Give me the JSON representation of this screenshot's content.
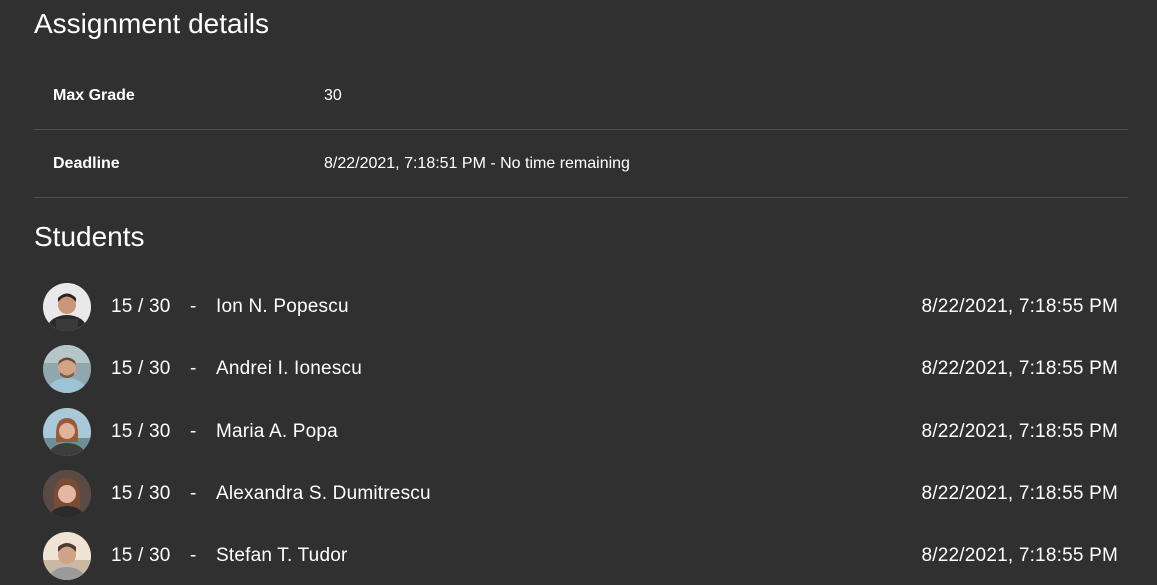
{
  "details": {
    "title": "Assignment details",
    "rows": [
      {
        "label": "Max Grade",
        "value": "30"
      },
      {
        "label": "Deadline",
        "value": "8/22/2021, 7:18:51 PM - No time remaining"
      }
    ]
  },
  "students": {
    "title": "Students",
    "separator": "-",
    "items": [
      {
        "grade": "15 / 30",
        "name": "Ion N. Popescu",
        "submitted_at": "8/22/2021, 7:18:55 PM"
      },
      {
        "grade": "15 / 30",
        "name": "Andrei I. Ionescu",
        "submitted_at": "8/22/2021, 7:18:55 PM"
      },
      {
        "grade": "15 / 30",
        "name": "Maria A. Popa",
        "submitted_at": "8/22/2021, 7:18:55 PM"
      },
      {
        "grade": "15 / 30",
        "name": "Alexandra S. Dumitrescu",
        "submitted_at": "8/22/2021, 7:18:55 PM"
      },
      {
        "grade": "15 / 30",
        "name": "Stefan T. Tudor",
        "submitted_at": "8/22/2021, 7:18:55 PM"
      }
    ]
  },
  "colors": {
    "background": "#303030",
    "divider": "#4f4f4f",
    "text": "#ffffff"
  }
}
